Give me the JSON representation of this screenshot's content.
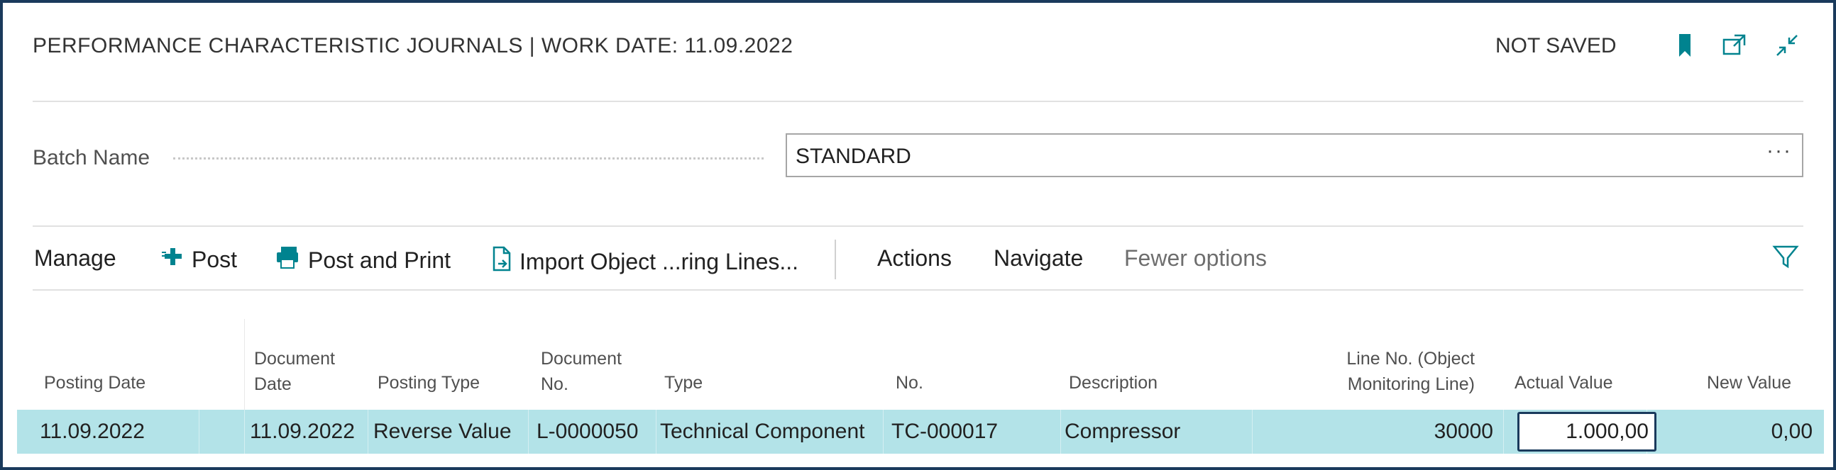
{
  "header": {
    "title": "PERFORMANCE CHARACTERISTIC JOURNALS | WORK DATE: 11.09.2022",
    "status": "NOT SAVED",
    "icons": [
      "bookmark-icon",
      "open-new-window-icon",
      "collapse-icon"
    ],
    "accent_color": "#00838f"
  },
  "batch": {
    "label": "Batch Name",
    "value": "STANDARD",
    "more": "···"
  },
  "toolbar": {
    "manage": "Manage",
    "post": "Post",
    "post_and_print": "Post and Print",
    "import": "Import Object ...ring Lines...",
    "actions": "Actions",
    "navigate": "Navigate",
    "fewer_options": "Fewer options"
  },
  "columns": {
    "posting_date": "Posting Date",
    "document_date_1": "Document",
    "document_date_2": "Date",
    "posting_type": "Posting Type",
    "document_no_1": "Document",
    "document_no_2": "No.",
    "type": "Type",
    "no": "No.",
    "description": "Description",
    "line_no_1": "Line No. (Object",
    "line_no_2": "Monitoring Line)",
    "actual_value": "Actual Value",
    "new_value": "New Value"
  },
  "rows": [
    {
      "posting_date": "11.09.2022",
      "document_date": "11.09.2022",
      "posting_type": "Reverse Value",
      "document_no": "L-0000050",
      "type": "Technical Component",
      "no": "TC-000017",
      "description": "Compressor",
      "line_no": "30000",
      "actual_value": "1.000,00",
      "new_value": "0,00"
    }
  ],
  "colors": {
    "selected_row": "#b3e3e8",
    "border": "#1a3a5c"
  }
}
